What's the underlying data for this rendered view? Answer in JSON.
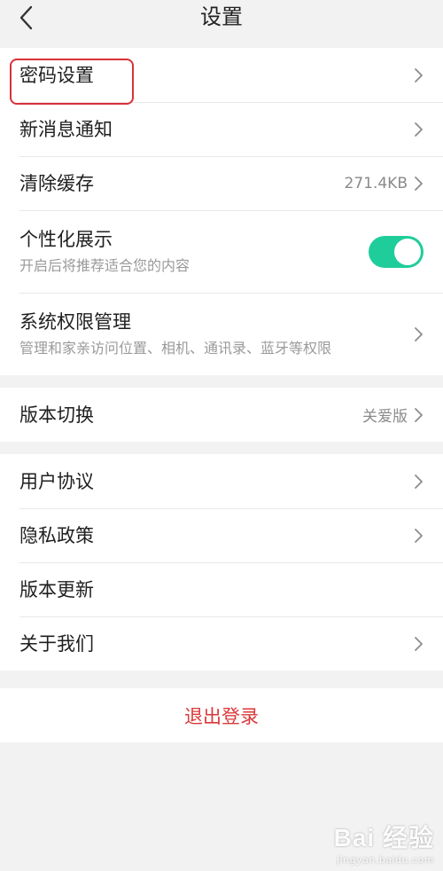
{
  "header": {
    "title": "设置",
    "back_icon": "chevron-left-icon"
  },
  "group1": {
    "password": {
      "label": "密码设置"
    },
    "notification": {
      "label": "新消息通知"
    },
    "cache": {
      "label": "清除缓存",
      "value": "271.4KB"
    },
    "personalized": {
      "label": "个性化展示",
      "sub": "开启后将推荐适合您的内容",
      "enabled": true
    },
    "permissions": {
      "label": "系统权限管理",
      "sub": "管理和家亲访问位置、相机、通讯录、蓝牙等权限"
    }
  },
  "group2": {
    "version_switch": {
      "label": "版本切换",
      "value": "关爱版"
    }
  },
  "group3": {
    "agreement": {
      "label": "用户协议"
    },
    "privacy": {
      "label": "隐私政策"
    },
    "update": {
      "label": "版本更新"
    },
    "about": {
      "label": "关于我们"
    }
  },
  "logout": {
    "label": "退出登录"
  },
  "watermark": {
    "main": "Bai 经验",
    "sub": "jingyan.baidu.com"
  },
  "colors": {
    "accent_toggle": "#1fcd9a",
    "logout_text": "#d9393a",
    "highlight_border": "#d8313a",
    "background": "#f2f2f2"
  }
}
